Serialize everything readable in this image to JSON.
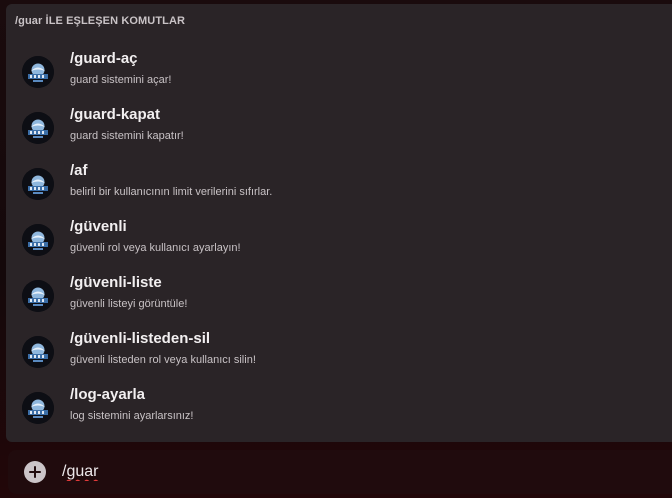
{
  "autocomplete": {
    "header": "/guar İLE EŞLEŞEN KOMUTLAR",
    "avatar_icon": "bot-avatar-icon",
    "commands": [
      {
        "name": "/guard-aç",
        "description": "guard sistemini açar!"
      },
      {
        "name": "/guard-kapat",
        "description": "guard sistemini kapatır!"
      },
      {
        "name": "/af",
        "description": "belirli bir kullanıcının limit verilerini sıfırlar."
      },
      {
        "name": "/güvenli",
        "description": "güvenli rol veya kullanıcı ayarlayın!"
      },
      {
        "name": "/güvenli-liste",
        "description": "güvenli listeyi görüntüle!"
      },
      {
        "name": "/güvenli-listeden-sil",
        "description": "güvenli listeden rol veya kullanıcı silin!"
      },
      {
        "name": "/log-ayarla",
        "description": "log sistemini ayarlarsınız!"
      }
    ]
  },
  "composer": {
    "add_icon": "plus-circle-icon",
    "input_value": "/guar"
  },
  "colors": {
    "popup_bg": "#2a2427",
    "composer_bg": "#200b0d",
    "page_bg": "#1a0b0d",
    "text_primary": "#f2eff0",
    "text_secondary": "#c8c2c5",
    "spellcheck": "#e23a3a"
  }
}
